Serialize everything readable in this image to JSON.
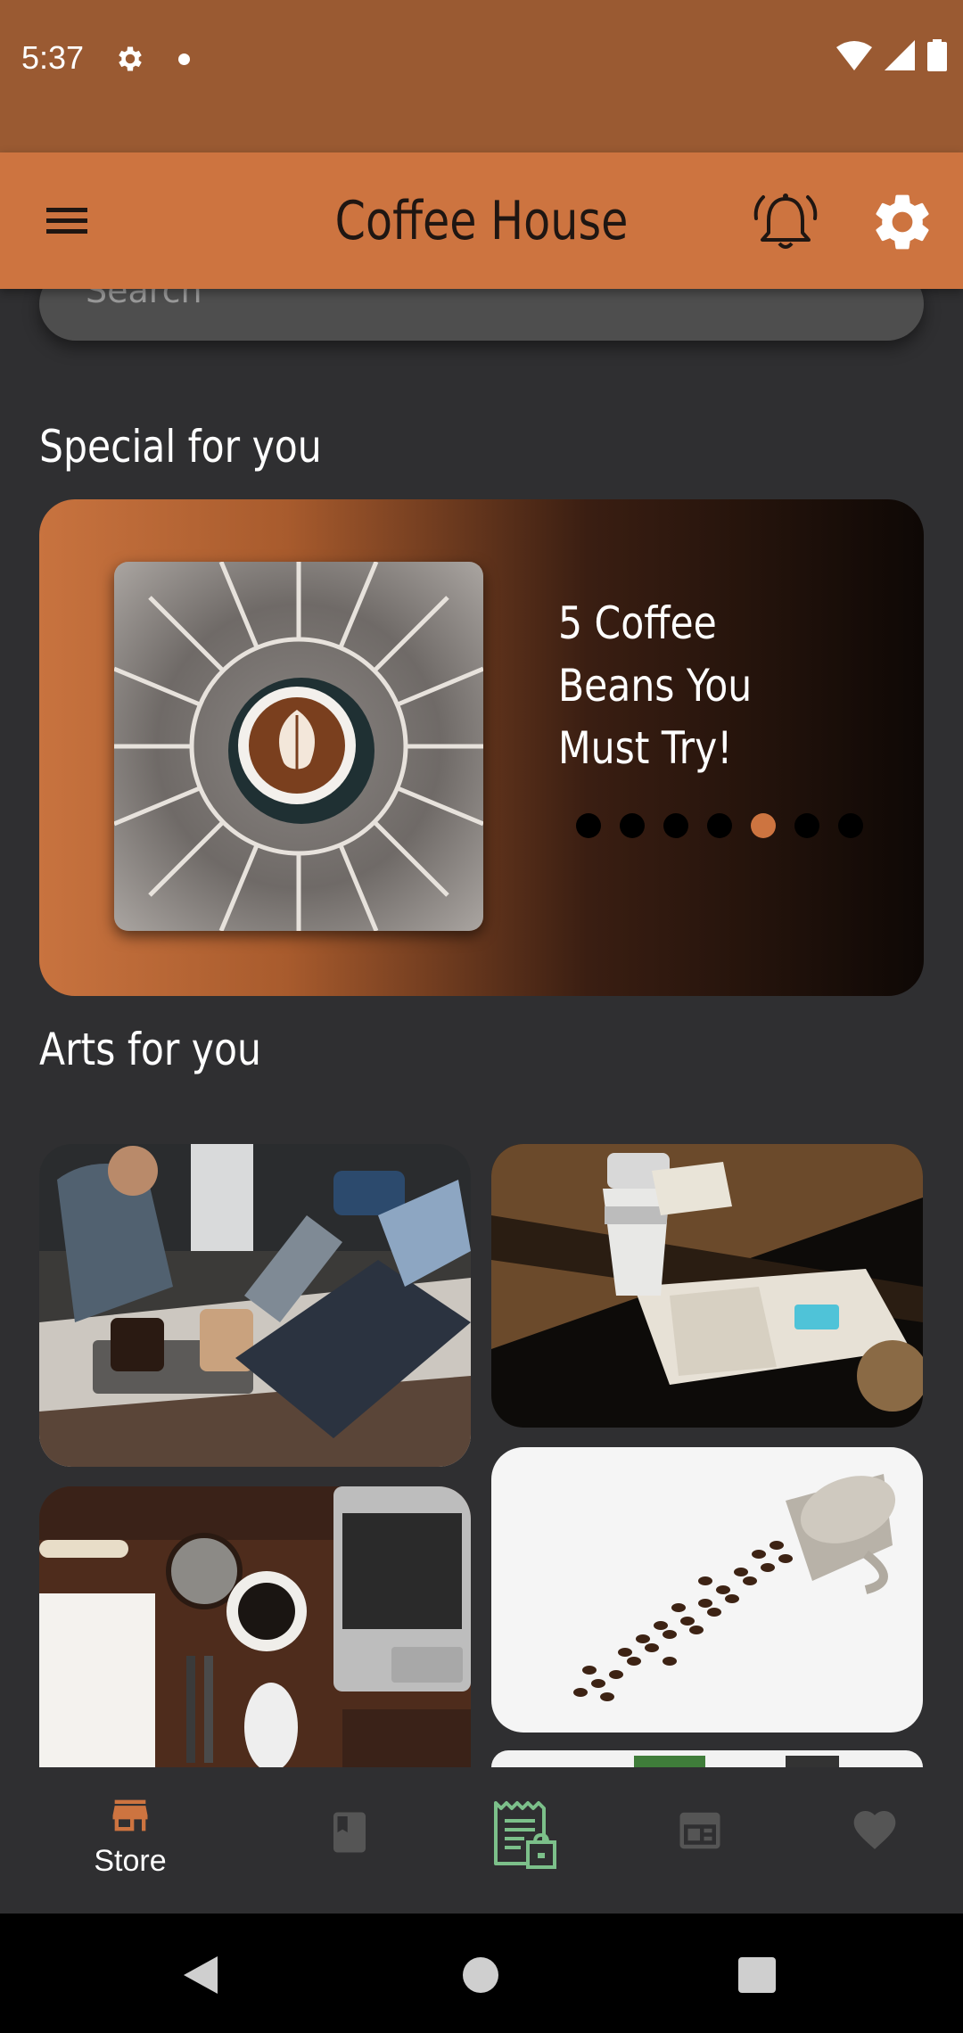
{
  "status_bar": {
    "time": "5:37"
  },
  "app_bar": {
    "title": "Coffee House"
  },
  "search": {
    "placeholder": "Search"
  },
  "sections": {
    "special": "Special for you",
    "arts": "Arts for you"
  },
  "special_card": {
    "headline": "5 Coffee Beans You Must Try!",
    "carousel": {
      "count": 7,
      "active_index": 4
    }
  },
  "bottom_nav": {
    "items": [
      {
        "icon": "store-icon",
        "label": "Store",
        "color": "#cd7440"
      },
      {
        "icon": "book-icon",
        "label": "",
        "color": "#555555"
      },
      {
        "icon": "receipt-icon",
        "label": "",
        "color": "#7cc08a"
      },
      {
        "icon": "newspaper-icon",
        "label": "",
        "color": "#555555"
      },
      {
        "icon": "heart-icon",
        "label": "",
        "color": "#555555"
      }
    ]
  },
  "colors": {
    "brand": "#cd7440",
    "status_bar": "#9a5a32",
    "background": "#2f2f31"
  }
}
